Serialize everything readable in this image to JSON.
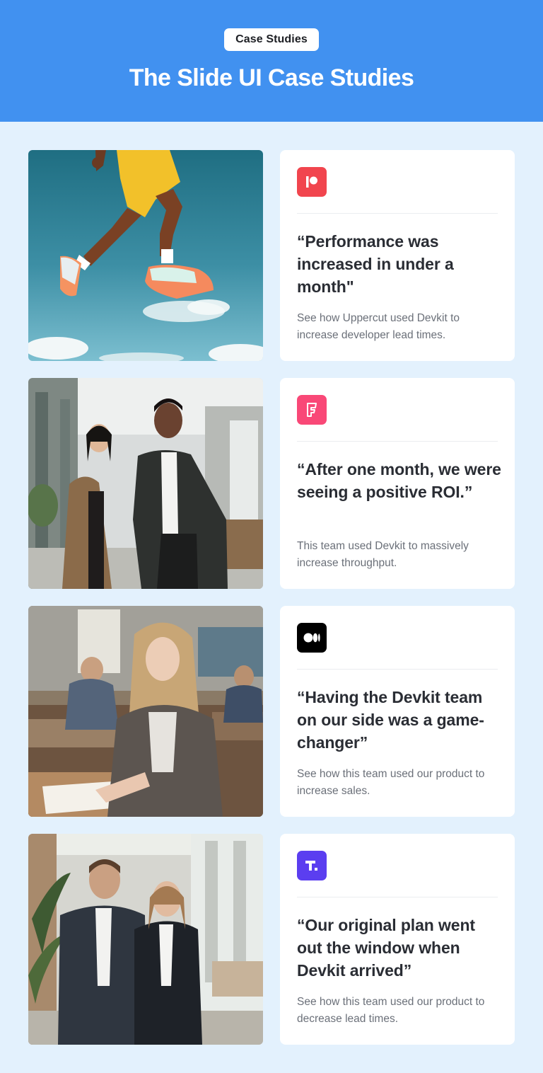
{
  "header": {
    "badge": "Case Studies",
    "title": "The Slide UI Case Studies"
  },
  "colors": {
    "header_bg": "#4191f0",
    "page_bg": "#e3f1fd"
  },
  "case_studies": [
    {
      "logo": "patreon-icon",
      "logo_color": "#f1454e",
      "quote": "“Performance was increased in under a month\"",
      "description": "See how Uppercut used Devkit to increase developer lead times.",
      "image": "athlete-jumping-sky-photo"
    },
    {
      "logo": "foursquare-icon",
      "logo_color": "#f94877",
      "quote": "“After one month, we were seeing a positive ROI.”",
      "description": "This team used Devkit to massively increase throughput.",
      "image": "two-colleagues-office-photo"
    },
    {
      "logo": "medium-icon",
      "logo_color": "#000000",
      "quote": "“Having the Devkit team on our side was a game-changer”",
      "description": "See how this team used our product to increase sales.",
      "image": "student-classroom-photo"
    },
    {
      "logo": "tiktok-t-icon",
      "logo_color": "#5b3ef0",
      "quote": "“Our original plan went out the window when Devkit arrived”",
      "description": "See how this team used our product to decrease lead times.",
      "image": "business-couple-office-photo"
    }
  ]
}
